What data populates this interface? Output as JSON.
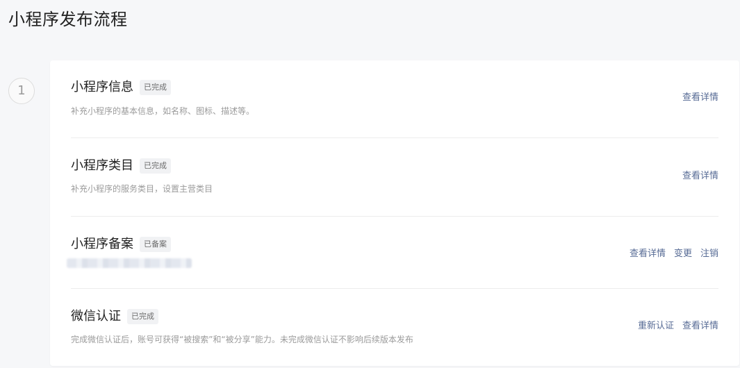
{
  "page": {
    "title": "小程序发布流程"
  },
  "step": {
    "number": "1"
  },
  "rows": [
    {
      "title": "小程序信息",
      "badge": "已完成",
      "description": "补充小程序的基本信息，如名称、图标、描述等。",
      "actions": [
        "查看详情"
      ]
    },
    {
      "title": "小程序类目",
      "badge": "已完成",
      "description": "补充小程序的服务类目，设置主营类目",
      "actions": [
        "查看详情"
      ]
    },
    {
      "title": "小程序备案",
      "badge": "已备案",
      "description": "",
      "actions": [
        "查看详情",
        "变更",
        "注销"
      ]
    },
    {
      "title": "微信认证",
      "badge": "已完成",
      "description": "完成微信认证后，账号可获得“被搜索”和“被分享”能力。未完成微信认证不影响后续版本发布",
      "actions": [
        "重新认证",
        "查看详情"
      ]
    }
  ]
}
